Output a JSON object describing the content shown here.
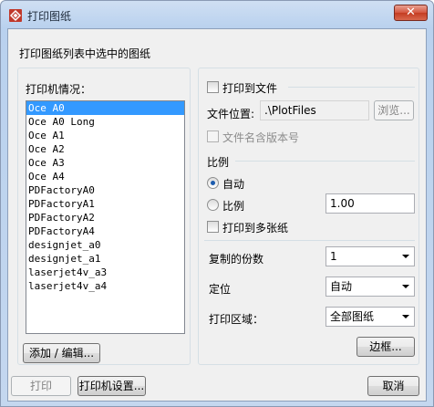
{
  "window": {
    "title": "打印图纸",
    "close_glyph": "✕",
    "icon": "plot-app-icon"
  },
  "header": "打印图纸列表中选中的图纸",
  "left": {
    "list_label": "打印机情况：",
    "printers": [
      "Oce A0",
      "Oce A0 Long",
      "Oce A1",
      "Oce A2",
      "Oce A3",
      "Oce A4",
      "PDFactoryA0",
      "PDFactoryA1",
      "PDFactoryA2",
      "PDFactoryA4",
      "designjet_a0",
      "designjet_a1",
      "laserjet4v_a3",
      "laserjet4v_a4"
    ],
    "selected_printer": "Oce A0",
    "add_edit_button": "添加 / 编辑..."
  },
  "right": {
    "print_to_file": {
      "label": "打印到文件",
      "checked": false
    },
    "file_location": {
      "label": "文件位置:",
      "value": ".\\PlotFiles",
      "browse_button": "浏览..."
    },
    "filename_version": {
      "label": "文件名含版本号",
      "checked": false
    },
    "scale": {
      "section_label": "比例",
      "auto_label": "自动",
      "custom_label": "比例",
      "selected": "自动",
      "value": "1.00"
    },
    "multi_sheet": {
      "label": "打印到多张纸",
      "checked": false
    },
    "copies": {
      "label": "复制的份数",
      "value": "1"
    },
    "position": {
      "label": "定位",
      "value": "自动"
    },
    "print_area": {
      "label": "打印区域：",
      "value": "全部图纸"
    },
    "border_button": "边框..."
  },
  "footer": {
    "print_button": "打印",
    "printer_settings_button": "打印机设置...",
    "cancel_button": "取消"
  },
  "colors": {
    "selection": "#3399ff",
    "radio_dot": "#1d5cae",
    "close_button": "#c43c22"
  }
}
